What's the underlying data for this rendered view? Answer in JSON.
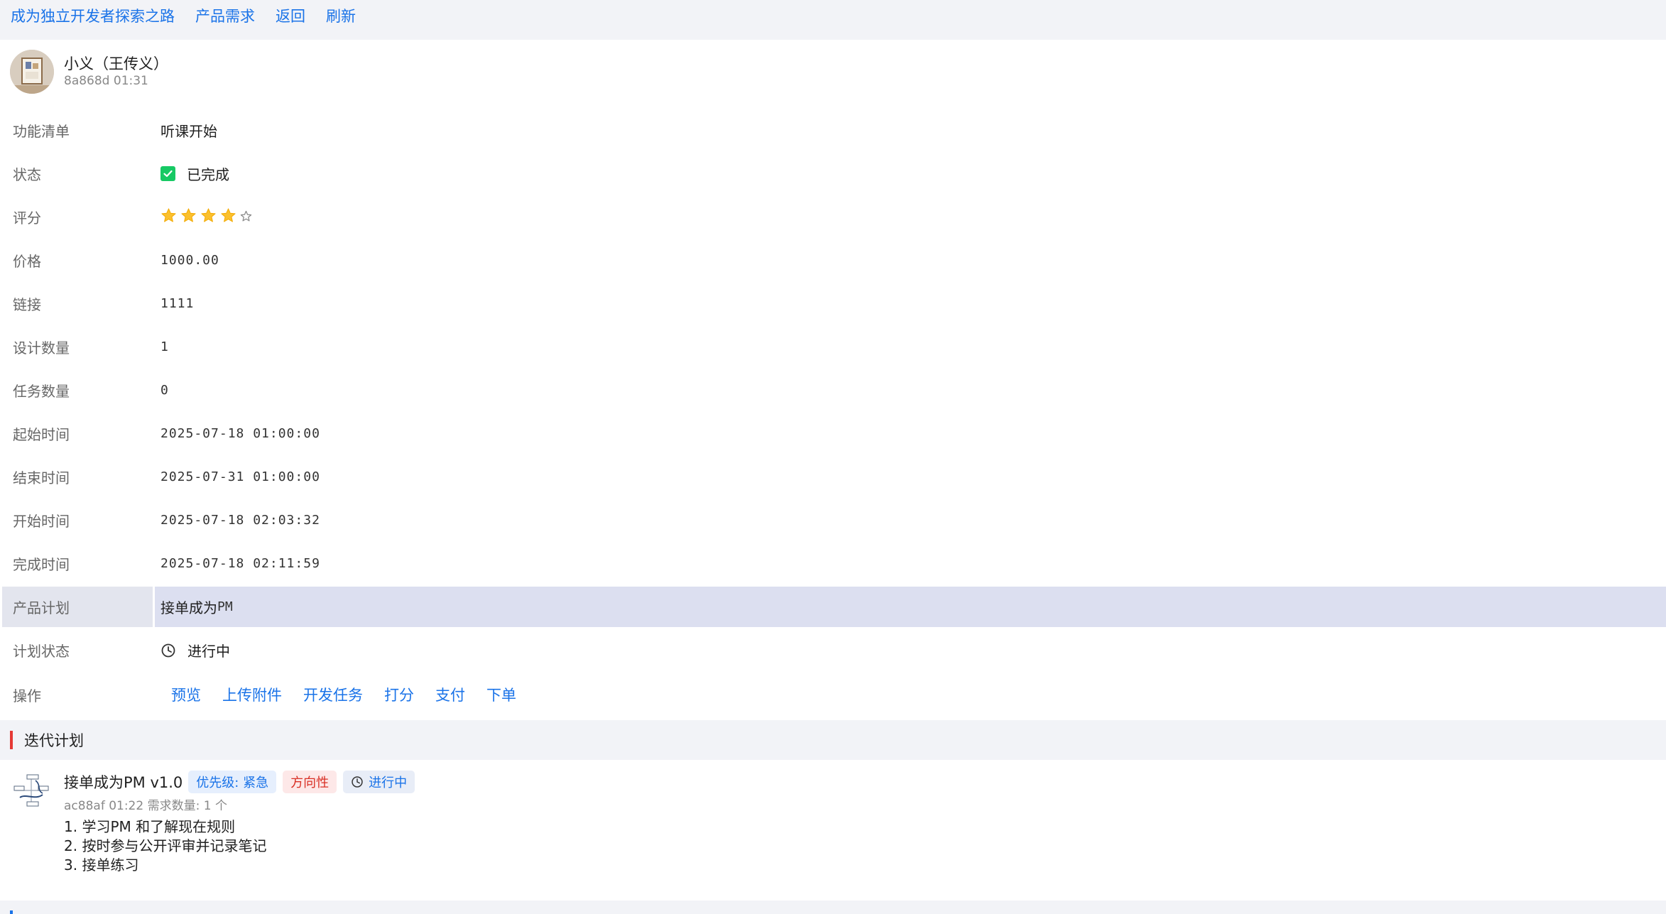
{
  "nav": {
    "links": [
      "成为独立开发者探索之路",
      "产品需求",
      "返回",
      "刷新"
    ]
  },
  "author": {
    "name": "小义（王传义）",
    "meta": "8a868d 01:31"
  },
  "props": {
    "feature": {
      "label": "功能清单",
      "value": "听课开始"
    },
    "status": {
      "label": "状态",
      "value": "已完成"
    },
    "rating": {
      "label": "评分",
      "value": 4,
      "max": 5
    },
    "price": {
      "label": "价格",
      "value": "1000.00"
    },
    "link": {
      "label": "链接",
      "value": "1111"
    },
    "design_count": {
      "label": "设计数量",
      "value": "1"
    },
    "task_count": {
      "label": "任务数量",
      "value": "0"
    },
    "start_time": {
      "label": "起始时间",
      "value": "2025-07-18 01:00:00"
    },
    "end_time": {
      "label": "结束时间",
      "value": "2025-07-31 01:00:00"
    },
    "begin_time": {
      "label": "开始时间",
      "value": "2025-07-18 02:03:32"
    },
    "finish_time": {
      "label": "完成时间",
      "value": "2025-07-18 02:11:59"
    },
    "plan": {
      "label": "产品计划",
      "value_cn": "接单成为",
      "value_en": "PM"
    },
    "plan_status": {
      "label": "计划状态",
      "value": "进行中"
    },
    "actions": {
      "label": "操作",
      "items": [
        "预览",
        "上传附件",
        "开发任务",
        "打分",
        "支付",
        "下单"
      ]
    }
  },
  "section": {
    "title": "迭代计划"
  },
  "iteration": {
    "title": "接单成为PM v1.0",
    "tags": {
      "priority": "优先级: 紧急",
      "direction": "方向性",
      "status": "进行中"
    },
    "meta": "ac88af 01:22 需求数量: 1 个",
    "items": [
      "1. 学习PM 和了解现在规则",
      "2. 按时参与公开评审并记录笔记",
      "3. 接单练习"
    ]
  },
  "colors": {
    "link": "#1a73e8",
    "check": "#17c964",
    "star": "#fbc02d",
    "section_bar": "#e53935",
    "highlight": "#dcdff0"
  }
}
